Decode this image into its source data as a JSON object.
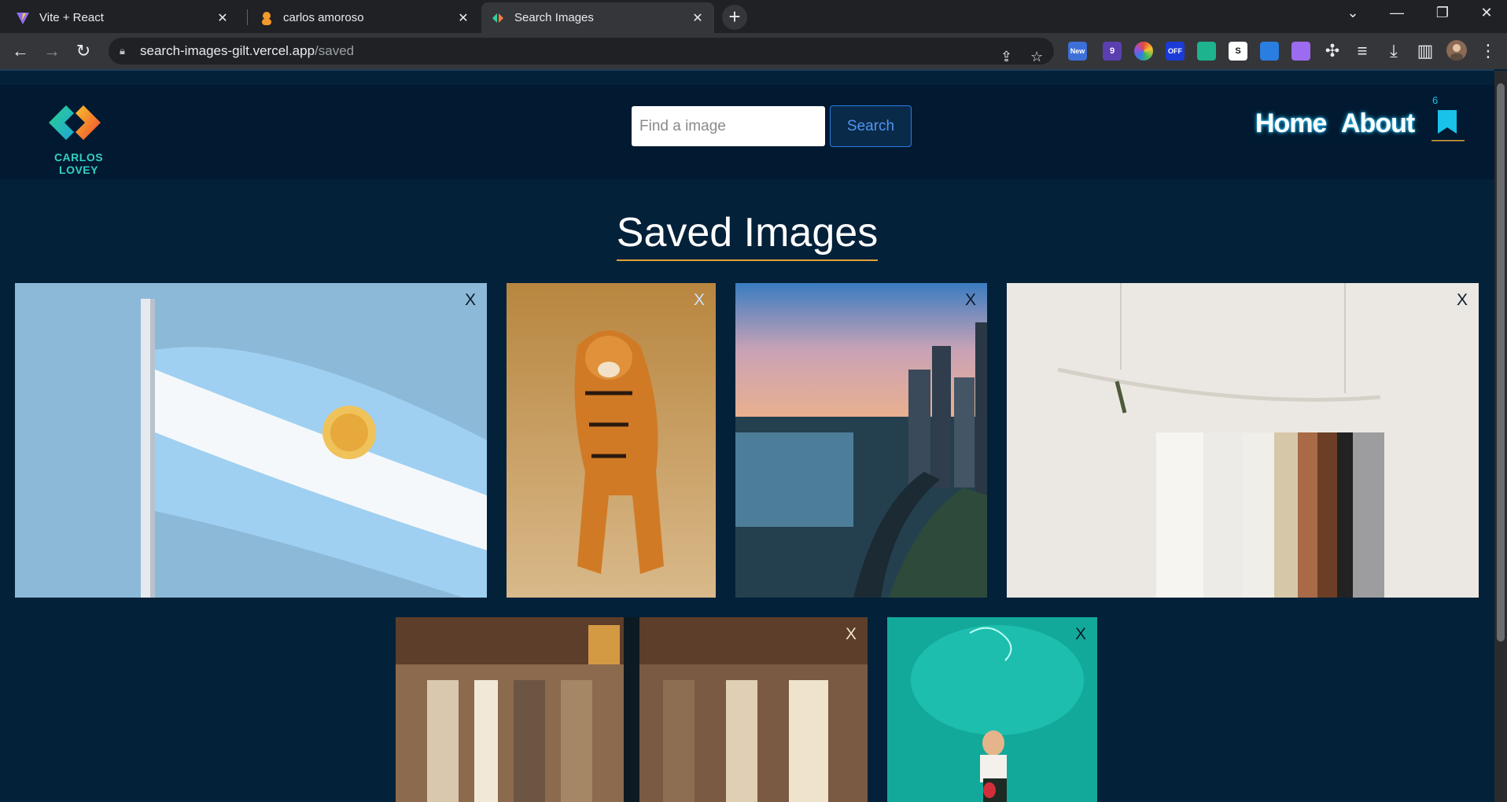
{
  "browser": {
    "tabs": [
      {
        "title": "Vite + React",
        "icon": "vite-icon"
      },
      {
        "title": "carlos amoroso",
        "icon": "user-icon"
      },
      {
        "title": "Search Images",
        "icon": "search-images-icon"
      }
    ],
    "url_host": "search-images-gilt.vercel.app",
    "url_path": "/saved",
    "extensions": [
      {
        "label": "New",
        "color": "#3d6fd8"
      },
      {
        "label": "9",
        "color": "#5b3fb0"
      },
      {
        "label": "",
        "color": "#e8623a"
      },
      {
        "label": "OFF",
        "color": "#1a3bd8"
      },
      {
        "label": "",
        "color": "#1db38e"
      },
      {
        "label": "S",
        "color": "#111111"
      },
      {
        "label": "",
        "color": "#2a7de1"
      },
      {
        "label": "",
        "color": "#9d6bf0"
      }
    ]
  },
  "site": {
    "brand": "CARLOS LOVEY",
    "search": {
      "placeholder": "Find a image",
      "button": "Search"
    },
    "nav": {
      "home": "Home",
      "about": "About"
    },
    "saved_count": "6",
    "accent": "#19c2e8"
  },
  "main": {
    "title": "Saved Images",
    "close_label": "X",
    "images": [
      {
        "subject": "Argentine flag"
      },
      {
        "subject": "Tiger walking"
      },
      {
        "subject": "City skyline at dusk"
      },
      {
        "subject": "Clothes on hanging rack"
      },
      {
        "subject": "Clothing store racks"
      },
      {
        "subject": "Neon sign woman"
      }
    ]
  }
}
